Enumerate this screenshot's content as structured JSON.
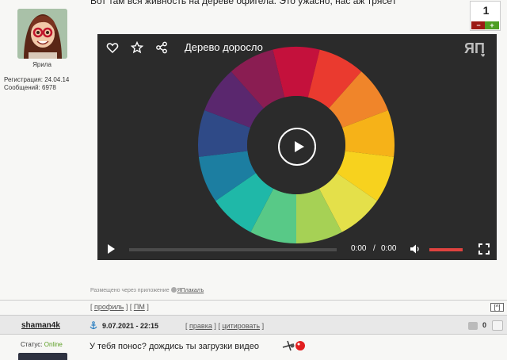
{
  "post_prev": {
    "cut_text": "Вот там вся живность на дереве офигела. Это ужасно, нас аж трясёт",
    "author": {
      "name": "Ярила",
      "registration": "Регистрация: 24.04.14",
      "messages": "Сообщений: 6978"
    },
    "vote": {
      "count": "1",
      "minus": "−",
      "plus": "+"
    },
    "video": {
      "title": "Дерево доросло",
      "time_current": "0:00",
      "time_sep": "/",
      "time_total": "0:00",
      "progress": 0,
      "volume": 1.0,
      "logo": "ЯП",
      "wheel_colors": [
        "#c4113c",
        "#ea3a2f",
        "#f0852a",
        "#f6b218",
        "#f7d21e",
        "#e4e04a",
        "#a6d155",
        "#58c987",
        "#1fb8a8",
        "#1c7ea1",
        "#2f4a87",
        "#5a276e",
        "#8a1d52"
      ]
    },
    "via": {
      "text": "Размещено через приложение",
      "app": "ЯПлакалъ"
    },
    "links": {
      "profile": "профиль",
      "pm": "ПМ",
      "open": "[",
      "sep": "] [",
      "close": "]",
      "up": "[^]"
    }
  },
  "post_next": {
    "username": "shaman4k",
    "date": "9.07.2021 - 22:15",
    "actions": {
      "edit": "правка",
      "quote": "цитировать",
      "open": "[",
      "sep": "] [",
      "close": "]"
    },
    "rating": "0",
    "status_label": "Статус:",
    "status_value": "Online",
    "text": "У тебя понос? дождись ты загрузки видео"
  },
  "colors": {
    "accent_green": "#5a9e22",
    "vote_minus": "#9c1a15",
    "vote_plus": "#4e9e23",
    "volume_fill": "#e0433f",
    "player_bg": "#2b2b2b"
  }
}
